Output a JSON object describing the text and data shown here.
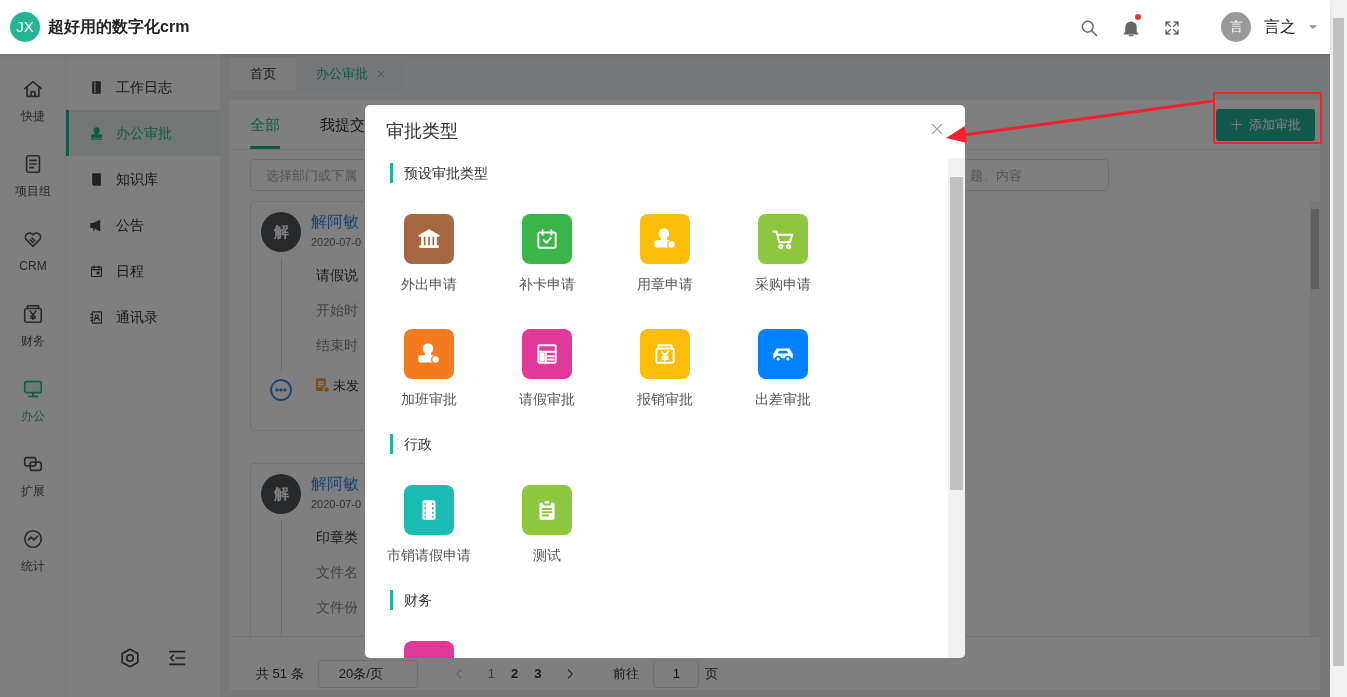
{
  "header": {
    "logo": "JX",
    "title": "超好用的数字化crm",
    "unread": true,
    "user": {
      "avatar": "言",
      "name": "言之"
    }
  },
  "rail": [
    {
      "label": "快捷",
      "selected": false
    },
    {
      "label": "项目组",
      "selected": false
    },
    {
      "label": "CRM",
      "selected": false
    },
    {
      "label": "财务",
      "selected": false
    },
    {
      "label": "办公",
      "selected": true
    },
    {
      "label": "扩展",
      "selected": false
    },
    {
      "label": "统计",
      "selected": false
    }
  ],
  "submenu": [
    {
      "label": "工作日志",
      "selected": false
    },
    {
      "label": "办公审批",
      "selected": true
    },
    {
      "label": "知识库",
      "selected": false
    },
    {
      "label": "公告",
      "selected": false
    },
    {
      "label": "日程",
      "selected": false
    },
    {
      "label": "通讯录",
      "selected": false
    }
  ],
  "page_tabs": [
    {
      "label": "首页",
      "selected": false,
      "closable": false
    },
    {
      "label": "办公审批",
      "selected": true,
      "closable": true
    }
  ],
  "content": {
    "tabs": [
      {
        "label": "全部",
        "selected": true
      },
      {
        "label": "我提交",
        "selected": false
      }
    ],
    "add_button": "添加审批",
    "filters": [
      {
        "placeholder": "选择部门或下属"
      },
      {
        "placeholder": "题、内容"
      }
    ],
    "records": [
      {
        "avatar": "解",
        "name": "解阿敏",
        "date": "2020-07-0",
        "fields": [
          {
            "kind": "title",
            "text": "请假说"
          },
          {
            "kind": "field",
            "text": "开始时"
          },
          {
            "kind": "field",
            "text": "结束时"
          }
        ],
        "status": "未发"
      },
      {
        "avatar": "解",
        "name": "解阿敏",
        "date": "2020-07-0",
        "fields": [
          {
            "kind": "title",
            "text": "印章类"
          },
          {
            "kind": "field",
            "text": "文件名"
          },
          {
            "kind": "field",
            "text": "文件份"
          }
        ]
      }
    ],
    "pagination": {
      "total": "共 51 条",
      "page_size": "20条/页",
      "pages": [
        {
          "label": "1",
          "selected": true
        },
        {
          "label": "2",
          "selected": false
        },
        {
          "label": "3",
          "selected": false
        }
      ],
      "goto_label": "前往",
      "goto_value": "1",
      "goto_suffix": "页"
    }
  },
  "dialog": {
    "title": "审批类型",
    "sections": [
      {
        "title": "预设审批类型",
        "items": [
          {
            "label": "外出申请",
            "color": "#a5673f"
          },
          {
            "label": "补卡申请",
            "color": "#39b54a"
          },
          {
            "label": "用章申请",
            "color": "#fbbd08"
          },
          {
            "label": "采购申请",
            "color": "#8dc63f"
          },
          {
            "label": "加班审批",
            "color": "#f37b1d"
          },
          {
            "label": "请假审批",
            "color": "#e03997"
          },
          {
            "label": "报销审批",
            "color": "#fbbd08"
          },
          {
            "label": "出差审批",
            "color": "#0081ff"
          }
        ]
      },
      {
        "title": "行政",
        "items": [
          {
            "label": "市销请假申请",
            "color": "#1cbbb4"
          },
          {
            "label": "测试",
            "color": "#8dc63f"
          }
        ]
      },
      {
        "title": "财务",
        "items": [
          {
            "color": "#e03997"
          }
        ]
      }
    ]
  }
}
